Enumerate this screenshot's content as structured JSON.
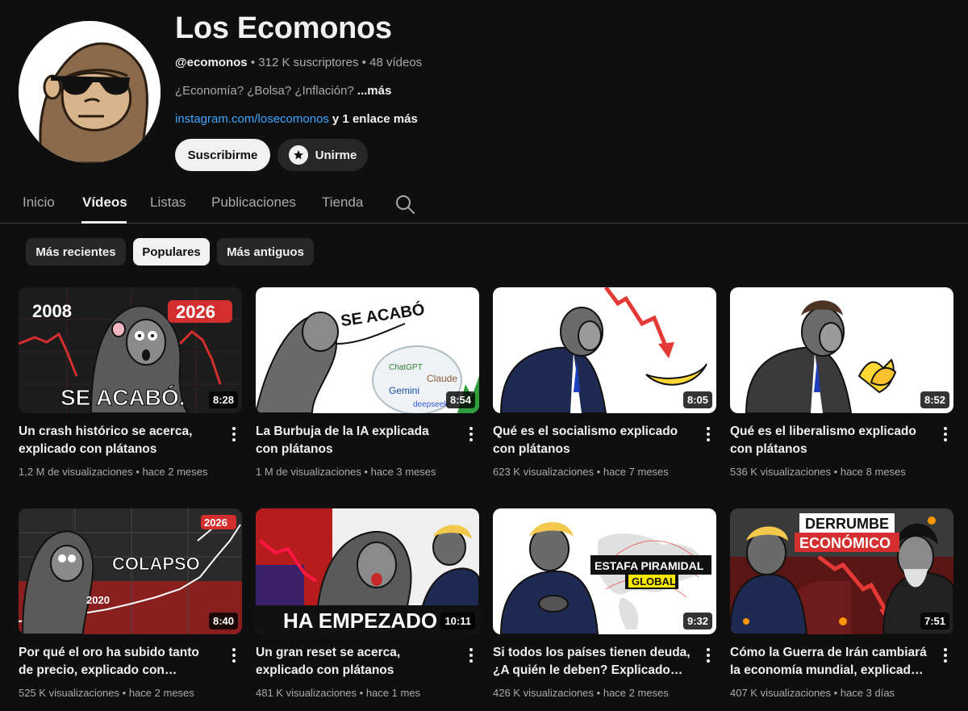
{
  "channel": {
    "name": "Los Ecomonos",
    "handle": "@ecomonos",
    "subscribers": "312 K suscriptores",
    "video_count": "48 vídeos",
    "separator": "•",
    "description": "¿Economía? ¿Bolsa? ¿Inflación?",
    "more_label": "...más",
    "link_text": "instagram.com/losecomonos",
    "extra_links": "y 1 enlace más",
    "avatar_icon": "gorilla-sunglasses-avatar"
  },
  "actions": {
    "subscribe_label": "Suscribirme",
    "join_label": "Unirme",
    "join_icon": "star-icon"
  },
  "tabs": [
    {
      "label": "Inicio",
      "active": false
    },
    {
      "label": "Vídeos",
      "active": true
    },
    {
      "label": "Listas",
      "active": false
    },
    {
      "label": "Publicaciones",
      "active": false
    },
    {
      "label": "Tienda",
      "active": false
    }
  ],
  "search_icon": "search-icon",
  "chips": [
    {
      "label": "Más recientes",
      "selected": false
    },
    {
      "label": "Populares",
      "selected": true
    },
    {
      "label": "Más antiguos",
      "selected": false
    }
  ],
  "videos": [
    {
      "title": "Un crash histórico se acerca, explicado con plátanos",
      "views": "1,2 M de visualizaciones",
      "age": "hace 2 meses",
      "duration": "8:28",
      "thumb_text": {
        "left": "2008",
        "right": "2026",
        "caption": "SE ACABÓ."
      }
    },
    {
      "title": "La Burbuja de la IA explicada con plátanos",
      "views": "1 M de visualizaciones",
      "age": "hace 3 meses",
      "duration": "8:54",
      "thumb_text": {
        "caption": "SE ACABÓ",
        "a": "ChatGPT",
        "b": "Claude",
        "c": "Gemini",
        "d": "deepseek"
      }
    },
    {
      "title": "Qué es el socialismo explicado con plátanos",
      "views": "623 K visualizaciones",
      "age": "hace 7 meses",
      "duration": "8:05"
    },
    {
      "title": "Qué es el liberalismo explicado con plátanos",
      "views": "536 K visualizaciones",
      "age": "hace 8 meses",
      "duration": "8:52"
    },
    {
      "title": "Por qué el oro ha subido tanto de precio, explicado con plátanos",
      "views": "525 K visualizaciones",
      "age": "hace 2 meses",
      "duration": "8:40",
      "thumb_text": {
        "caption": "COLAPSO",
        "right": "2026",
        "left": "2020"
      }
    },
    {
      "title": "Un gran reset se acerca, explicado con plátanos",
      "views": "481 K visualizaciones",
      "age": "hace 1 mes",
      "duration": "10:11",
      "thumb_text": {
        "caption": "HA EMPEZADO"
      }
    },
    {
      "title": "Si todos los países tienen deuda, ¿A quién le deben? Explicado con plátanos",
      "views": "426 K visualizaciones",
      "age": "hace 2 meses",
      "duration": "9:32",
      "thumb_text": {
        "caption": "ESTAFA PIRAMIDAL",
        "sub": "GLOBAL"
      }
    },
    {
      "title": "Cómo la Guerra de Irán cambiará la economía mundial, explicado con plátanos",
      "views": "407 K visualizaciones",
      "age": "hace 3 días",
      "duration": "7:51",
      "thumb_text": {
        "caption": "DERRUMBE",
        "sub": "ECONÓMICO"
      }
    }
  ],
  "colors": {
    "background": "#0f0f0f",
    "text": "#f1f1f1",
    "muted": "#aaaaaa",
    "link": "#3ea6ff",
    "chip": "#272727"
  }
}
